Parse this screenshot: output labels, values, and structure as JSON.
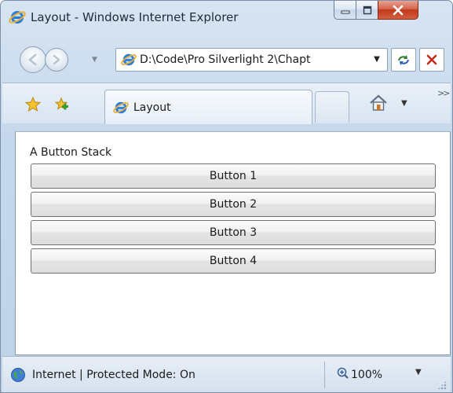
{
  "window": {
    "title": "Layout - Windows Internet Explorer"
  },
  "nav": {
    "address": "D:\\Code\\Pro Silverlight 2\\Chapt"
  },
  "tabs": [
    {
      "label": "Layout"
    }
  ],
  "page": {
    "label": "A Button Stack",
    "buttons": [
      "Button 1",
      "Button 2",
      "Button 3",
      "Button 4"
    ]
  },
  "status": {
    "zone": "Internet | Protected Mode: On",
    "zoom": "100%"
  },
  "colors": {
    "chrome": "#c6d8ec",
    "close_button": "#c2391c",
    "content_bg": "#ffffff"
  },
  "icons": {
    "app": "ie-icon",
    "back": "back-arrow-icon",
    "forward": "forward-arrow-icon",
    "refresh": "refresh-icon",
    "stop": "stop-icon",
    "favorites": "star-icon",
    "add_favorite": "add-favorite-icon",
    "home": "home-icon",
    "globe": "globe-icon",
    "zoom": "zoom-icon"
  }
}
